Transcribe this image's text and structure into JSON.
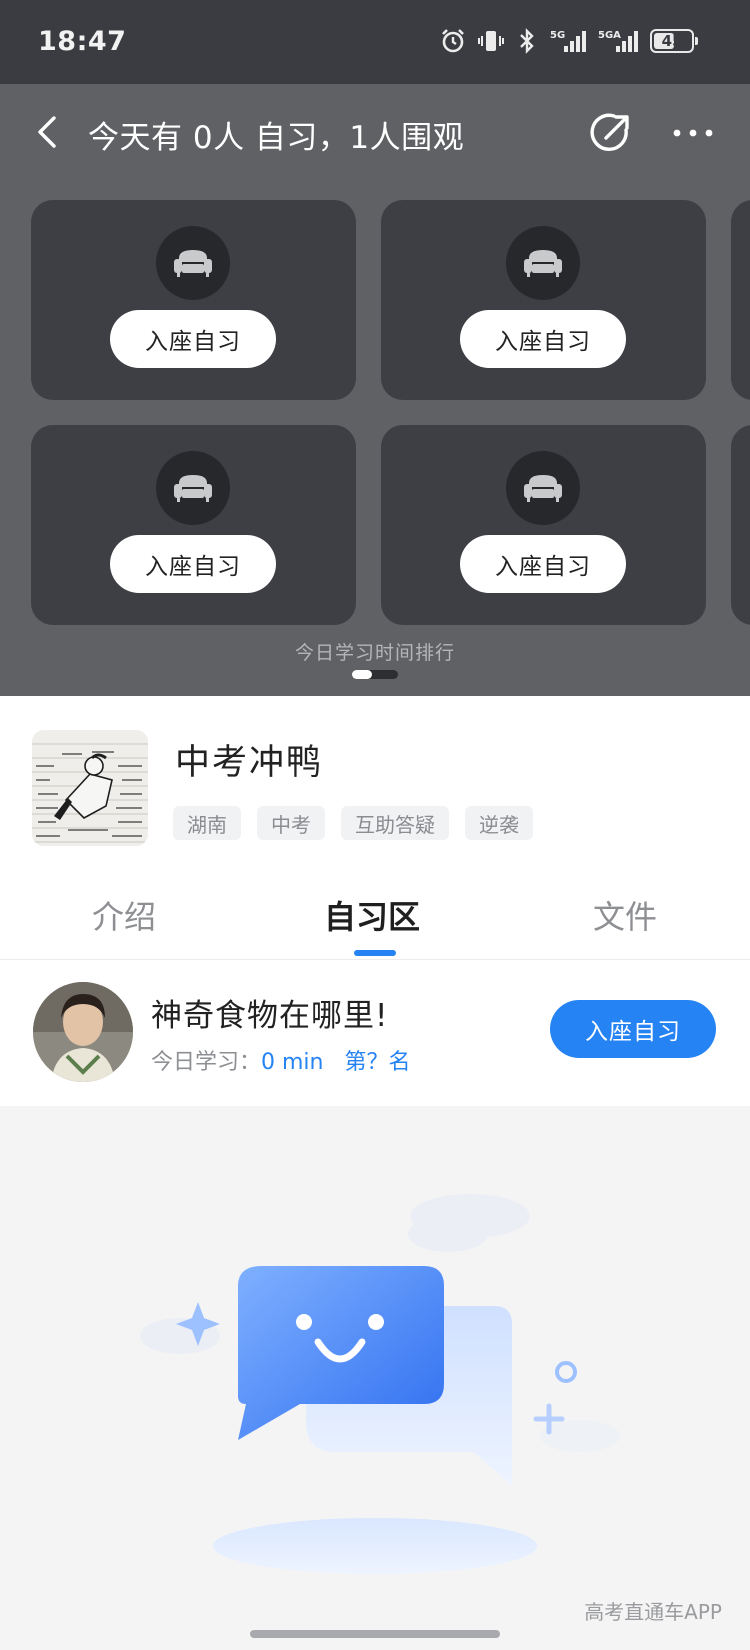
{
  "status_bar": {
    "time": "18:47",
    "network": "5G",
    "network2": "5GA",
    "battery": "45"
  },
  "nav": {
    "title": "今天有 0人 自习，1人围观"
  },
  "seats": {
    "button_label": "入座自习"
  },
  "ranking": {
    "label": "今日学习时间排行"
  },
  "group": {
    "name": "中考冲鸭",
    "tags": [
      "湖南",
      "中考",
      "互助答疑",
      "逆袭"
    ]
  },
  "tabs": [
    {
      "label": "介绍",
      "active": false
    },
    {
      "label": "自习区",
      "active": true
    },
    {
      "label": "文件",
      "active": false
    }
  ],
  "user": {
    "name": "神奇食物在哪里!",
    "stats_prefix": "今日学习：",
    "minutes": "0 min",
    "rank": "第？名",
    "button_label": "入座自习"
  },
  "watermark": "高考直通车APP",
  "colors": {
    "accent": "#2683f3",
    "dark_bg": "#606164",
    "card_bg": "#3d3f44"
  }
}
